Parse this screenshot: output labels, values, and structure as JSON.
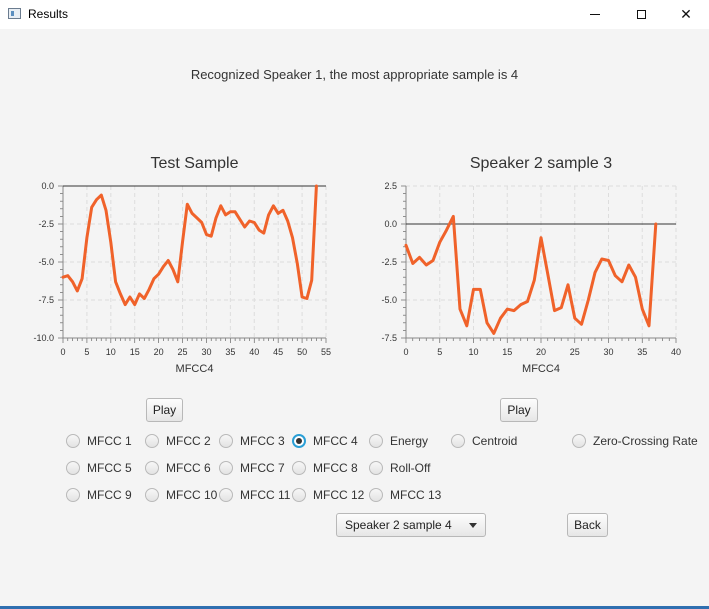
{
  "window": {
    "title": "Results",
    "icon": "window-app-icon"
  },
  "result_text": "Recognized Speaker 1, the most appropriate sample is 4",
  "buttons": {
    "play_left": "Play",
    "play_right": "Play",
    "back": "Back"
  },
  "radios": {
    "mfcc1": "MFCC 1",
    "mfcc2": "MFCC 2",
    "mfcc3": "MFCC 3",
    "mfcc4": "MFCC 4",
    "mfcc5": "MFCC 5",
    "mfcc6": "MFCC 6",
    "mfcc7": "MFCC 7",
    "mfcc8": "MFCC 8",
    "mfcc9": "MFCC 9",
    "mfcc10": "MFCC 10",
    "mfcc11": "MFCC 11",
    "mfcc12": "MFCC 12",
    "mfcc13": "MFCC 13",
    "energy": "Energy",
    "centroid": "Centroid",
    "rolloff": "Roll-Off",
    "zcr": "Zero-Crossing Rate",
    "selected": "MFCC 4"
  },
  "combo": {
    "value": "Speaker 2 sample 4"
  },
  "colors": {
    "line": "#f0622a",
    "accent": "#2a9fd6",
    "grid": "#dddddd"
  },
  "chart_data": [
    {
      "type": "line",
      "title": "Test Sample",
      "xlabel": "MFCC4",
      "ylabel": "",
      "xlim": [
        0,
        55
      ],
      "ylim": [
        -10,
        0
      ],
      "x_ticks": [
        0,
        5,
        10,
        15,
        20,
        25,
        30,
        35,
        40,
        45,
        50,
        55
      ],
      "y_ticks": [
        0.0,
        -2.5,
        -5.0,
        -7.5,
        -10.0
      ],
      "x_tick_labels": [
        "0",
        "5",
        "10",
        "15",
        "20",
        "25",
        "30",
        "35",
        "40",
        "45",
        "50",
        "55"
      ],
      "y_tick_labels": [
        "0.0",
        "-2.5",
        "-5.0",
        "-7.5",
        "-10.0"
      ],
      "grid": true,
      "series": [
        {
          "x": [
            0,
            1,
            2,
            3,
            4,
            5,
            6,
            7,
            8,
            9,
            10,
            11,
            12,
            13,
            14,
            15,
            16,
            17,
            18,
            19,
            20,
            21,
            22,
            23,
            24,
            25,
            26,
            27,
            28,
            29,
            30,
            31,
            32,
            33,
            34,
            35,
            36,
            37,
            38,
            39,
            40,
            41,
            42,
            43,
            44,
            45,
            46,
            47,
            48,
            49,
            50,
            51,
            52,
            53
          ],
          "values": [
            -6.0,
            -5.9,
            -6.3,
            -6.9,
            -6.1,
            -3.4,
            -1.4,
            -0.9,
            -0.6,
            -1.6,
            -3.7,
            -6.3,
            -7.1,
            -7.8,
            -7.3,
            -7.8,
            -7.1,
            -7.4,
            -6.8,
            -6.1,
            -5.8,
            -5.3,
            -4.9,
            -5.5,
            -6.3,
            -3.7,
            -1.2,
            -1.8,
            -2.1,
            -2.4,
            -3.2,
            -3.3,
            -2.1,
            -1.3,
            -1.9,
            -1.7,
            -1.7,
            -2.2,
            -2.7,
            -2.3,
            -2.4,
            -2.9,
            -3.1,
            -1.9,
            -1.3,
            -1.8,
            -1.6,
            -2.3,
            -3.4,
            -5.1,
            -7.3,
            -7.4,
            -6.2,
            0.0
          ]
        }
      ]
    },
    {
      "type": "line",
      "title": "Speaker 2 sample 3",
      "xlabel": "MFCC4",
      "ylabel": "",
      "xlim": [
        0,
        40
      ],
      "ylim": [
        -7.5,
        2.5
      ],
      "x_ticks": [
        0,
        5,
        10,
        15,
        20,
        25,
        30,
        35,
        40
      ],
      "y_ticks": [
        2.5,
        0.0,
        -2.5,
        -5.0,
        -7.5
      ],
      "x_tick_labels": [
        "0",
        "5",
        "10",
        "15",
        "20",
        "25",
        "30",
        "35",
        "40"
      ],
      "y_tick_labels": [
        "2.5",
        "0.0",
        "-2.5",
        "-5.0",
        "-7.5"
      ],
      "grid": true,
      "series": [
        {
          "x": [
            0,
            1,
            2,
            3,
            4,
            5,
            6,
            7,
            8,
            9,
            10,
            11,
            12,
            13,
            14,
            15,
            16,
            17,
            18,
            19,
            20,
            21,
            22,
            23,
            24,
            25,
            26,
            27,
            28,
            29,
            30,
            31,
            32,
            33,
            34,
            35,
            36,
            37
          ],
          "values": [
            -1.4,
            -2.6,
            -2.2,
            -2.7,
            -2.4,
            -1.2,
            -0.4,
            0.5,
            -5.6,
            -6.7,
            -4.3,
            -4.3,
            -6.5,
            -7.2,
            -6.2,
            -5.6,
            -5.7,
            -5.3,
            -5.1,
            -3.7,
            -0.9,
            -3.3,
            -5.7,
            -5.5,
            -4.0,
            -6.2,
            -6.6,
            -5.0,
            -3.2,
            -2.3,
            -2.4,
            -3.4,
            -3.8,
            -2.7,
            -3.5,
            -5.6,
            -6.7,
            0.0
          ]
        }
      ]
    }
  ]
}
